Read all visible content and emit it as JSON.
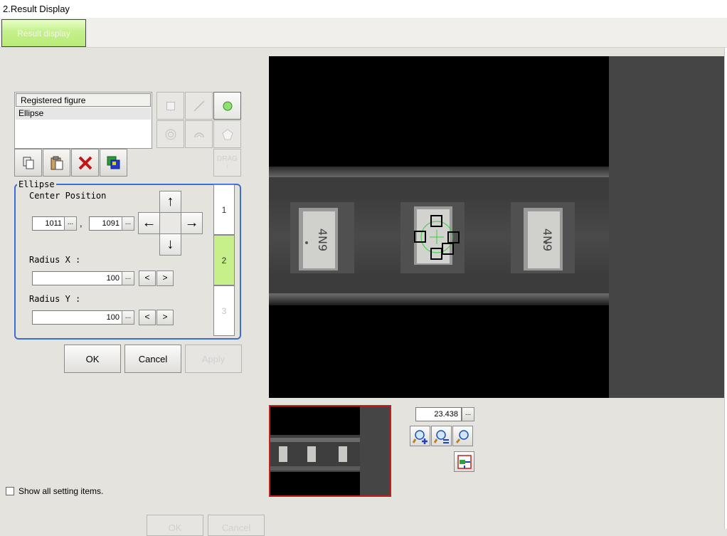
{
  "window": {
    "title": "2.Result Display"
  },
  "tabs": [
    {
      "label": "Result display",
      "active": true
    }
  ],
  "registered_figures": {
    "header": "Registered figure",
    "items": [
      "Ellipse"
    ],
    "selected_index": 0
  },
  "figure_tools": [
    {
      "icon": "rectangle-icon",
      "enabled": false
    },
    {
      "icon": "line-icon",
      "enabled": false
    },
    {
      "icon": "circle-icon",
      "enabled": true,
      "selected": true
    },
    {
      "icon": "wide-circle-icon",
      "enabled": false
    },
    {
      "icon": "arc-icon",
      "enabled": false
    },
    {
      "icon": "polygon-icon",
      "enabled": false
    },
    {
      "icon": "drag-icon",
      "label": "DRAG",
      "enabled": false
    }
  ],
  "edit_tools": [
    {
      "icon": "copy-icon"
    },
    {
      "icon": "paste-icon"
    },
    {
      "icon": "delete-icon"
    },
    {
      "icon": "layer-icon"
    }
  ],
  "ellipse": {
    "group_title": "Ellipse",
    "center_label": "Center Position",
    "center_x": "1011",
    "separator": ",",
    "center_y": "1091",
    "radius_x_label": "Radius X :",
    "radius_x": "100",
    "radius_y_label": "Radius Y :",
    "radius_y": "100",
    "dots": "...",
    "dec": "<",
    "inc": ">",
    "arrows": {
      "up": "↑",
      "down": "↓",
      "left": "←",
      "right": "→"
    }
  },
  "pages": [
    {
      "label": "1",
      "state": "normal"
    },
    {
      "label": "2",
      "state": "selected"
    },
    {
      "label": "3",
      "state": "disabled"
    }
  ],
  "dialog_buttons": {
    "ok": "OK",
    "cancel": "Cancel",
    "apply": "Apply"
  },
  "chip_label": "4N9",
  "zoom": {
    "value": "23.438",
    "dots": "..."
  },
  "zoom_buttons": [
    "zoom-in-icon",
    "zoom-out-icon",
    "zoom-fit-icon",
    "fit-window-icon"
  ],
  "show_all": {
    "label": "Show all setting items.",
    "checked": false
  },
  "bottom_buttons": {
    "ok": "OK",
    "cancel": "Cancel"
  },
  "colors": {
    "accent": "#3c6fd6",
    "active_tab": "#c4f08a",
    "selected_page": "#c8f08a",
    "nav_frame": "#c02020"
  }
}
